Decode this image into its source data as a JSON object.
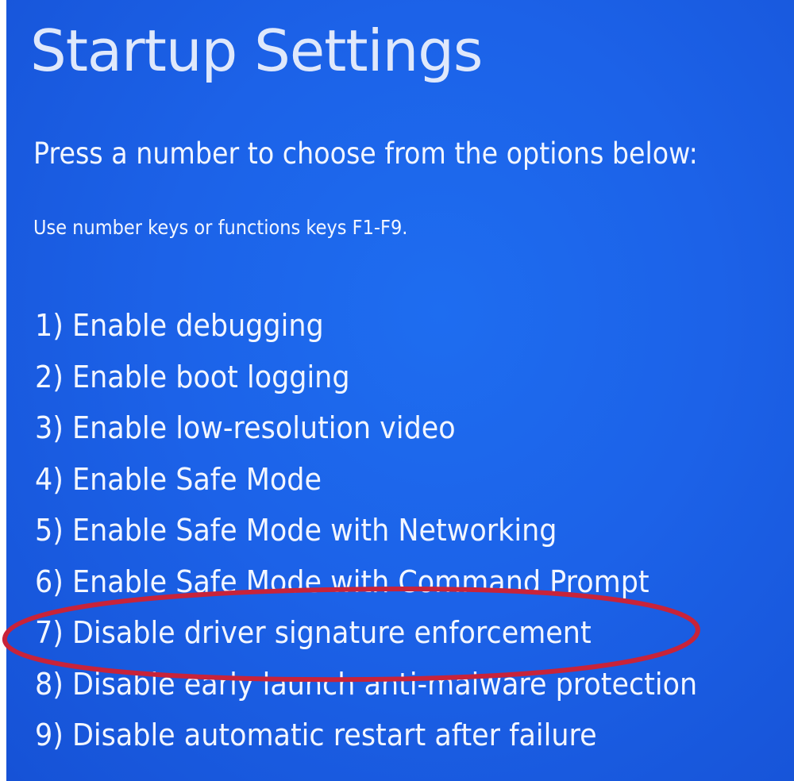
{
  "screen": {
    "title": "Startup Settings",
    "subtitle": "Press a number to choose from the options below:",
    "hint": "Use number keys or functions keys F1-F9.",
    "options": [
      "1) Enable debugging",
      "2) Enable boot logging",
      "3) Enable low-resolution video",
      "4) Enable Safe Mode",
      "5) Enable Safe Mode with Networking",
      "6) Enable Safe Mode with Command Prompt",
      "7) Disable driver signature enforcement",
      "8) Disable early launch anti-malware protection",
      "9) Disable automatic restart after failure"
    ]
  },
  "colors": {
    "background": "#1c62e8",
    "text": "#f2f6ff",
    "highlight_ring": "#c8233a"
  }
}
